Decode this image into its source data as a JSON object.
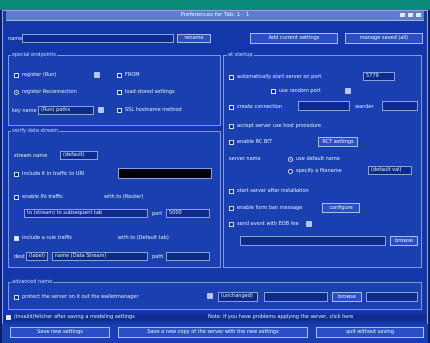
{
  "window": {
    "title": "Preferences for Tab: 1 - 1"
  },
  "top": {
    "name_label": "name",
    "name_value": "",
    "rename_btn": "rename",
    "add_btn": "Add current settings",
    "manage_btn": "manage saved (all)"
  },
  "special": {
    "legend": "special endpoints",
    "item1": "register (Run)",
    "item2": "FROM",
    "item3": "register Reconnection",
    "item4": "load stored settings",
    "item5_label": "key name",
    "item5_value": "(Run) paths",
    "item6": "SSL hostname method"
  },
  "data_stream": {
    "legend": "verify data stream",
    "buffer_label": "stream name",
    "buffer_value": "(default)",
    "chk1": "Include it in traffic to URI",
    "chk1_value": "",
    "chk2": "enable lfo traffic",
    "chk2_b": "with to (Router)",
    "rowA_label": "to (stream) to subsequent tab",
    "rowA_value": "port",
    "rowA_port": "5000",
    "chk3": "include a rule traffic",
    "chk3_b": "with to (Default tab)",
    "rowB_a": "dest",
    "rowB_b": "(label)",
    "rowB_c": "name (Data Stream)",
    "rowB_d": "path"
  },
  "at_startup": {
    "legend": "at startup",
    "c1": "automatically start server on port",
    "c1_val": "5779",
    "c2": "use random port",
    "c3": "create connection",
    "c3_b": "wander",
    "c4": "accept server use host procedure",
    "c5": "enable RC BIT",
    "c5_b": "RCT settings",
    "r_label": "server name",
    "r1": "use default name",
    "r2": "specify a filename",
    "r2_val": "(default val)",
    "c6": "start server after installation",
    "c7": "enable form ban message",
    "c7_btn": "configure",
    "c8": "send event with EOB fee",
    "browse_btn": "browse"
  },
  "extra": {
    "legend": "advanced name",
    "chk": "protect the server on it out the walletmanager",
    "sel": "(unchanged)",
    "btn": "browse"
  },
  "status": {
    "left": "(Invalid)fetcher after saving a modeling settings",
    "right": "Note: If you have problems applying the server, click here"
  },
  "bottom": {
    "b1": "Save new settings",
    "b2": "Save a new copy of the server with the new settings",
    "b3": "quit without saving"
  }
}
